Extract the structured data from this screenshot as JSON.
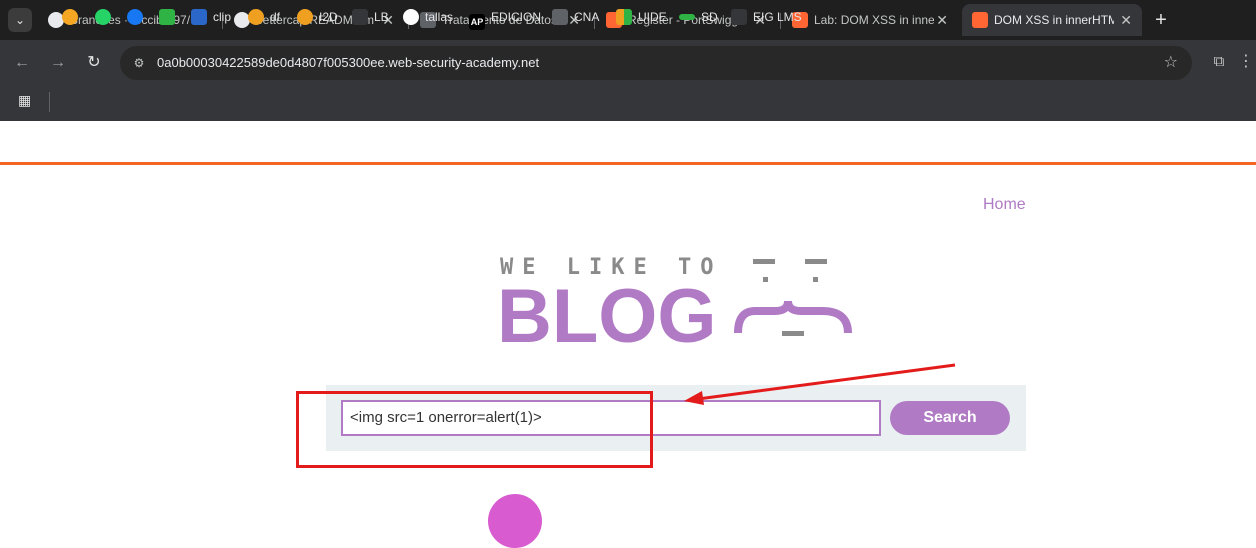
{
  "browser": {
    "tabs": [
      {
        "title": "Branches · tecciber97/",
        "icon": "github-icon",
        "color": "#ffffff"
      },
      {
        "title": "bettercap/README.m",
        "icon": "github-icon",
        "color": "#ffffff"
      },
      {
        "title": "Tratamiento de Datos",
        "icon": "doc-icon",
        "color": "#8a8a8a"
      },
      {
        "title": "Register - PortSwigge",
        "icon": "portswigger-icon",
        "color": "#ff6633"
      },
      {
        "title": "Lab: DOM XSS in inne",
        "icon": "portswigger-icon",
        "color": "#ff6633"
      },
      {
        "title": "DOM XSS in innerHTM",
        "icon": "portswigger-icon",
        "color": "#ff6633",
        "active": true
      }
    ],
    "url": "0a0b00030422589de0d4807f005300ee.web-security-academy.net",
    "bookmarks": [
      {
        "label": "",
        "icon": "info-icon",
        "color": "#f5a623"
      },
      {
        "label": "",
        "icon": "whatsapp-icon",
        "color": "#25d366"
      },
      {
        "label": "",
        "icon": "facebook-icon",
        "color": "#1877f2"
      },
      {
        "label": "",
        "icon": "green-square-icon",
        "color": "#2fb344"
      },
      {
        "label": "clip",
        "icon": "clip-icon",
        "color": "#2b66c9"
      },
      {
        "label": "df",
        "icon": "infinity-icon",
        "color": "#f0a020"
      },
      {
        "label": "I2D",
        "icon": "i2d-icon",
        "color": "#f0a020"
      },
      {
        "label": "LB",
        "icon": "lb-icon",
        "color": "#35363a"
      },
      {
        "label": "tallas",
        "icon": "f-icon",
        "color": "#ffffff"
      },
      {
        "label": "EDICION",
        "icon": "ap-icon",
        "color": "#000000"
      },
      {
        "label": "CNA",
        "icon": "cisco-icon",
        "color": "#9aa0a6"
      },
      {
        "label": "UIDE",
        "icon": "bars-icon",
        "color": "#f0a020"
      },
      {
        "label": "SD",
        "icon": "sd-icon",
        "color": "#2fb344"
      },
      {
        "label": "EIG LMS",
        "icon": "eig-icon",
        "color": "#35363a"
      }
    ]
  },
  "site": {
    "home_label": "Home",
    "logo_top": "WE LIKE TO",
    "logo_main": "BLOG",
    "search_value": "<img src=1 onerror=alert(1)>",
    "search_button": "Search"
  },
  "colors": {
    "accent": "#b07ac4",
    "orange_line": "#f26522",
    "annotation_red": "#e31b1b"
  }
}
